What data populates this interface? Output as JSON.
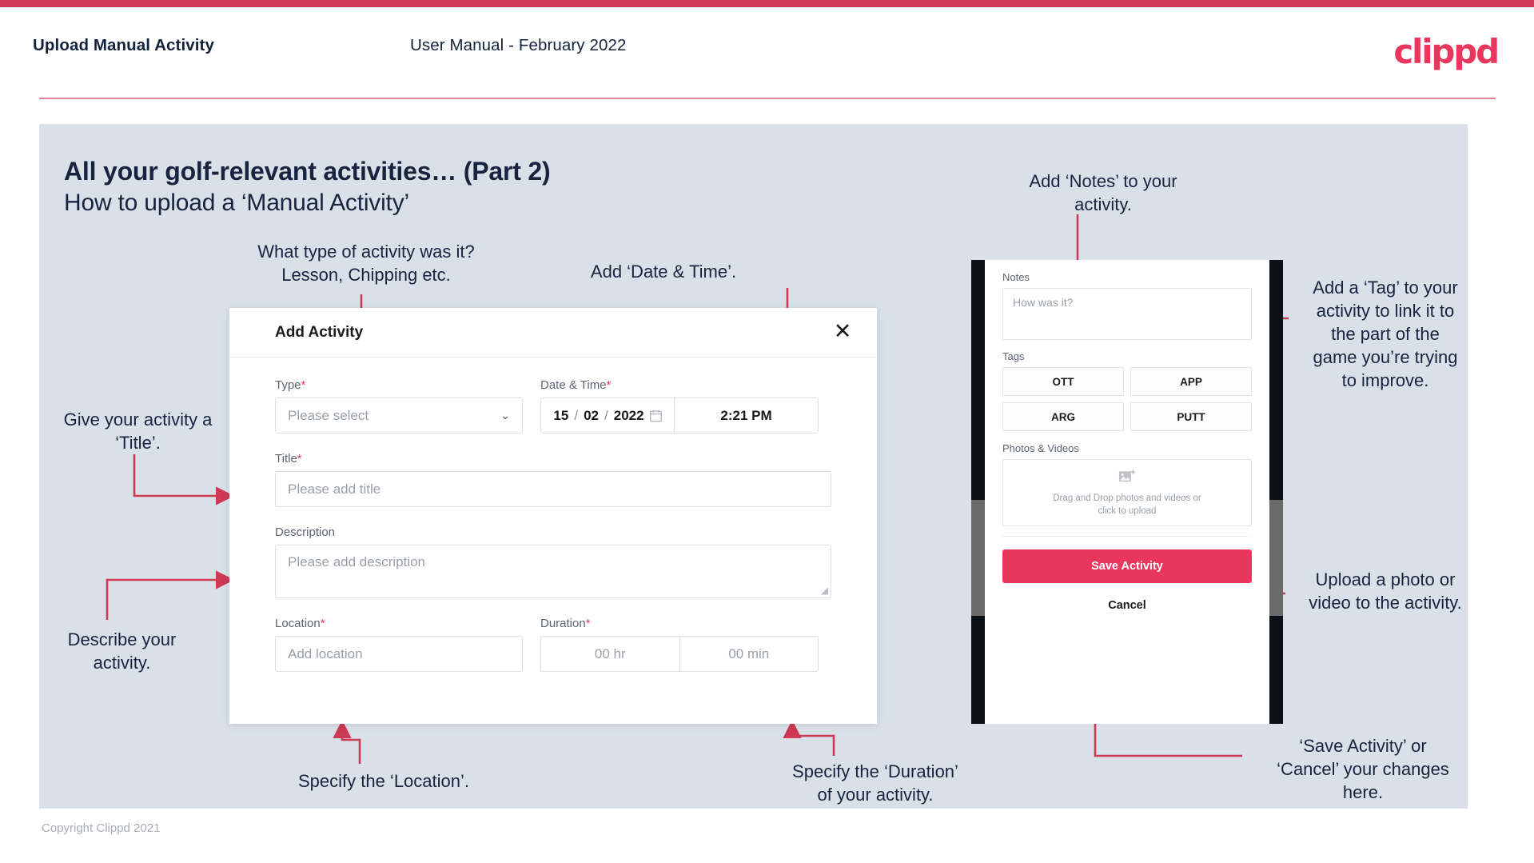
{
  "header": {
    "left_title": "Upload Manual Activity",
    "center_title": "User Manual - February 2022",
    "logo_text": "clippd"
  },
  "slide": {
    "title": "All your golf-relevant activities… (Part 2)",
    "subtitle": "How to upload a ‘Manual Activity’"
  },
  "dialog": {
    "title": "Add Activity",
    "close_icon": "✕",
    "fields": {
      "type": {
        "label": "Type",
        "required": "*",
        "placeholder": "Please select",
        "caret": "⌄"
      },
      "datetime": {
        "label": "Date & Time",
        "required": "*",
        "day": "15",
        "month": "02",
        "year": "2022",
        "sep": "/",
        "time": "2:21 PM"
      },
      "title": {
        "label": "Title",
        "required": "*",
        "placeholder": "Please add title"
      },
      "description": {
        "label": "Description",
        "placeholder": "Please add description"
      },
      "location": {
        "label": "Location",
        "required": "*",
        "placeholder": "Add location"
      },
      "duration": {
        "label": "Duration",
        "required": "*",
        "hours": "00 hr",
        "minutes": "00 min"
      }
    }
  },
  "phone": {
    "notes": {
      "label": "Notes",
      "placeholder": "How was it?"
    },
    "tags": {
      "label": "Tags",
      "items": [
        "OTT",
        "APP",
        "ARG",
        "PUTT"
      ]
    },
    "photos": {
      "label": "Photos & Videos",
      "dropzone_text": "Drag and Drop photos and videos or\nclick to upload"
    },
    "save_label": "Save Activity",
    "cancel_label": "Cancel"
  },
  "annotations": {
    "type": "What type of activity was it?\nLesson, Chipping etc.",
    "datetime": "Add ‘Date & Time’.",
    "title": "Give your activity a\n‘Title’.",
    "description": "Describe your\nactivity.",
    "location": "Specify the ‘Location’.",
    "duration": "Specify the ‘Duration’\nof your activity.",
    "notes": "Add ‘Notes’ to your\nactivity.",
    "tags": "Add a ‘Tag’ to your\nactivity to link it to\nthe part of the\ngame you’re trying\nto improve.",
    "upload": "Upload a photo or\nvideo to the activity.",
    "save": "‘Save Activity’ or\n‘Cancel’ your changes\nhere."
  },
  "footer": {
    "copyright": "Copyright Clippd 2021"
  },
  "colors": {
    "accent": "#e8365d",
    "bar": "#cc3a54",
    "panel": "#d9e0e8",
    "ink": "#18243f",
    "connector": "#cc3a54"
  }
}
